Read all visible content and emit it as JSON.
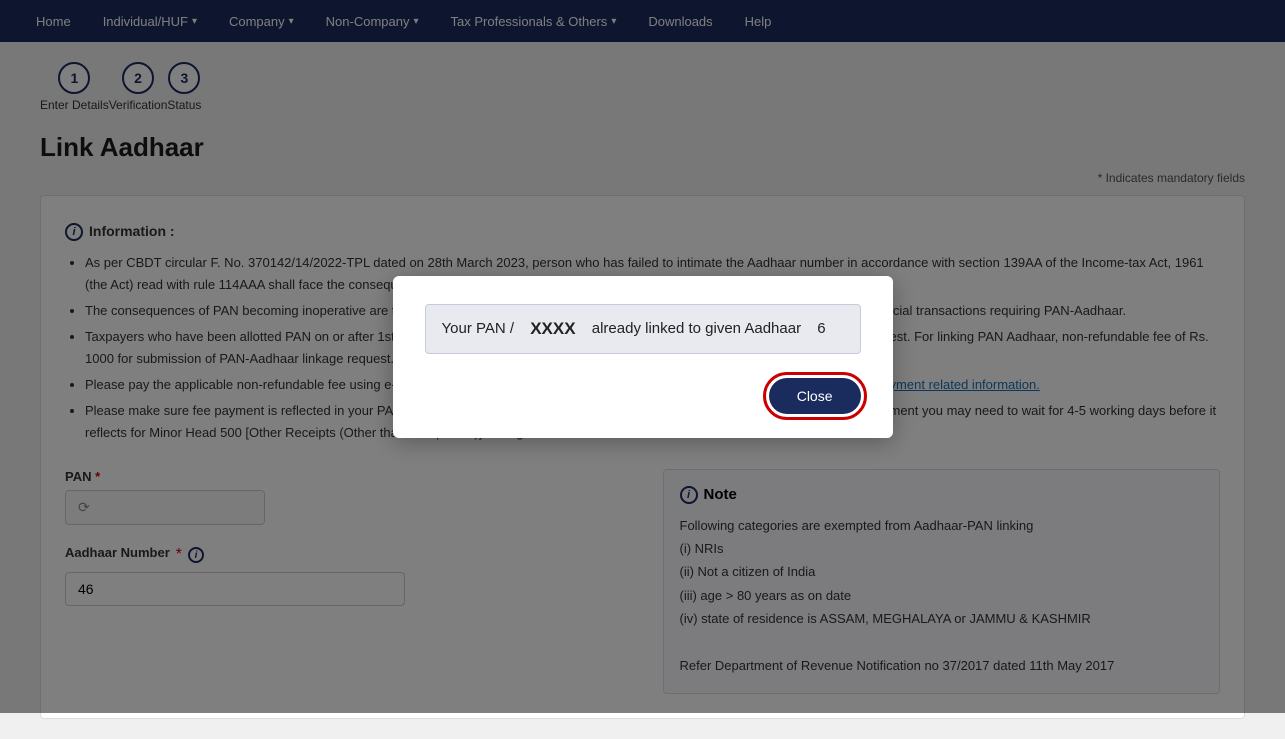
{
  "nav": {
    "items": [
      {
        "label": "Home",
        "hasArrow": false
      },
      {
        "label": "Individual/HUF",
        "hasArrow": true
      },
      {
        "label": "Company",
        "hasArrow": true
      },
      {
        "label": "Non-Company",
        "hasArrow": true
      },
      {
        "label": "Tax Professionals & Others",
        "hasArrow": true
      },
      {
        "label": "Downloads",
        "hasArrow": false
      },
      {
        "label": "Help",
        "hasArrow": false
      }
    ]
  },
  "stepper": {
    "steps": [
      {
        "number": "1",
        "label": "Enter Details"
      },
      {
        "number": "2",
        "label": "Verification"
      },
      {
        "number": "3",
        "label": "Status"
      }
    ]
  },
  "page": {
    "title": "Link Aadhaar",
    "mandatory_note": "* Indicates mandatory fields"
  },
  "info": {
    "title": "Information :",
    "bullets": [
      "As per CBDT circular F. No. 370142/14/2022-TPL dated on 28th March 2023, person who has failed to intimate the Aadhaar number in accordance with section 139AA of the Income-tax Act, 1961 (the Act) read with rule 114AAA shall face the consequences of the PAN becoming inoperative.",
      "The consequences of PAN becoming inoperative are the same as not furnishing PAN and include higher TDS/TCS rates, not able to do financial transactions requiring PAN-Aadhaar.",
      "Taxpayers who have been allotted PAN on or after 1st July 2017 are exempted from paying fee for submission of PAN-Aadhaar linkage request. For linking PAN Aadhaar, non-refundable fee of Rs. 1000 for submission of PAN-Aadhaar linkage request.",
      "Please pay the applicable non-refundable fee using e-Pay Tax functionality before submitting PAN-Aadhaar linking request. Click here for payment related information.",
      "Please make sure fee payment is reflected in your PAN before submitting a PAN-Aadhaar linking request. If you have recently made the payment you may need to wait for 4-5 working days before it reflects for Minor Head 500 [Other Receipts (Other than Companies)] in single challan."
    ],
    "link_text": "Click here for payment related information."
  },
  "form": {
    "pan_label": "PAN",
    "pan_value": "",
    "pan_placeholder": "◯",
    "aadhaar_label": "Aadhaar Number",
    "aadhaar_value": "46",
    "info_icon_label": "i"
  },
  "note": {
    "title": "Note",
    "items": [
      "Following categories are exempted from Aadhaar-PAN linking",
      "(i) NRIs",
      "(ii) Not a citizen of India",
      "(iii) age > 80 years as on date",
      "(iv) state of residence is ASSAM, MEGHALAYA or JAMMU & KASHMIR",
      "",
      "Refer Department of Revenue Notification no 37/2017 dated 11th May 2017"
    ]
  },
  "modal": {
    "message_prefix": "Your PAN /",
    "message_bold": "XXXX",
    "message_suffix": "already linked to given Aadhaar",
    "message_code": "6",
    "close_label": "Close"
  }
}
